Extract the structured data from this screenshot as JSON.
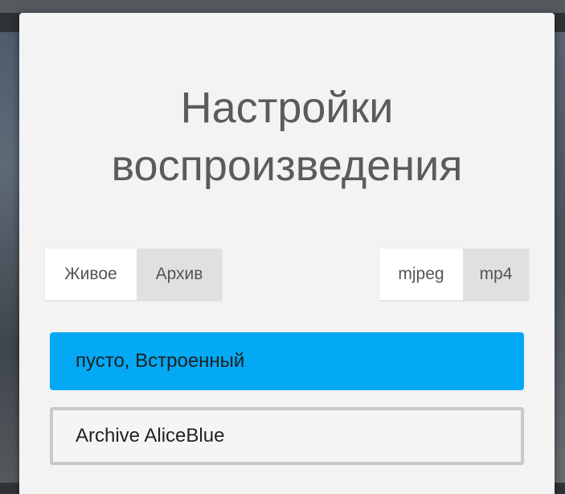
{
  "dialog": {
    "title_line1": "Настройки",
    "title_line2": "воспроизведения"
  },
  "mode_toggle": {
    "options": [
      "Живое",
      "Архив"
    ],
    "selected": "Живое"
  },
  "format_toggle": {
    "options": [
      "mjpeg",
      "mp4"
    ],
    "selected": "mjpeg"
  },
  "sources": {
    "items": [
      {
        "label": "пусто, Встроенный",
        "selected": true
      },
      {
        "label": "Archive AliceBlue",
        "selected": false
      }
    ]
  },
  "colors": {
    "accent": "#03a9f4",
    "dialog_bg": "#f3f3f3",
    "segment_active": "#ffffff",
    "segment_inactive": "#e0e0e0",
    "title_text": "#5b5b5b"
  }
}
